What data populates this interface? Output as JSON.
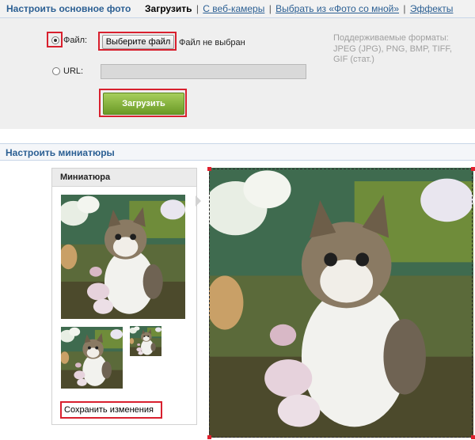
{
  "top": {
    "title": "Настроить основное фото",
    "tabs": {
      "upload": "Загрузить",
      "webcam": "С веб-камеры",
      "from_photos": "Выбрать из «Фото со мной»",
      "effects": "Эффекты"
    },
    "file_option_label": "Файл:",
    "choose_file_button": "Выберите файл",
    "no_file_text": "Файл не выбран",
    "url_option_label": "URL:",
    "url_input_value": "",
    "upload_button": "Загрузить",
    "formats_label": "Поддерживаемые форматы:",
    "formats_list": "JPEG (JPG), PNG, BMP, TIFF,",
    "formats_list_2": "GIF (стат.)"
  },
  "thumbnails": {
    "title": "Настроить миниатюры",
    "panel_title": "Миниатюра",
    "save_button": "Сохранить изменения"
  },
  "colors": {
    "accent_blue": "#2b5f93",
    "highlight_red": "#d8202e",
    "upload_green": "#6b9a26"
  },
  "images": {
    "main": "kitten-photo",
    "thumbnails": [
      "kitten-thumbnail-large",
      "kitten-thumbnail-medium",
      "kitten-thumbnail-small"
    ]
  }
}
